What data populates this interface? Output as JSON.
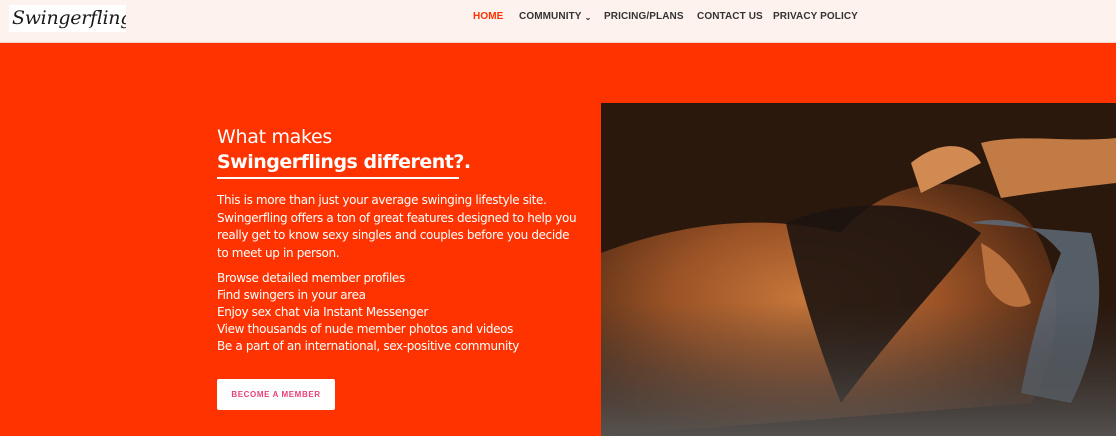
{
  "header": {
    "logo_text": "Swingerflings",
    "nav": {
      "home": "HOME",
      "community": "COMMUNITY",
      "pricing": "PRICING/PLANS",
      "contact": "CONTACT US",
      "privacy": "PRIVACY POLICY"
    },
    "chevron_icon": "chevron-down-icon",
    "active_color": "#ff3300"
  },
  "hero": {
    "heading_line1": "What makes",
    "heading_line2": "Swingerflings different?.",
    "intro": "This is more than just your average swinging lifestyle site. Swingerfling offers a ton of great features designed to help you really get to know sexy singles and couples before you decide to meet up in person.",
    "features": [
      "Browse detailed member profiles",
      "Find swingers in your area",
      "Enjoy sex chat via Instant Messenger",
      "View thousands of nude member photos and videos",
      "Be a part of an international, sex-positive community"
    ],
    "cta_label": "BECOME A MEMBER",
    "cta_color": "#e8407a",
    "background_color": "#ff3300"
  }
}
